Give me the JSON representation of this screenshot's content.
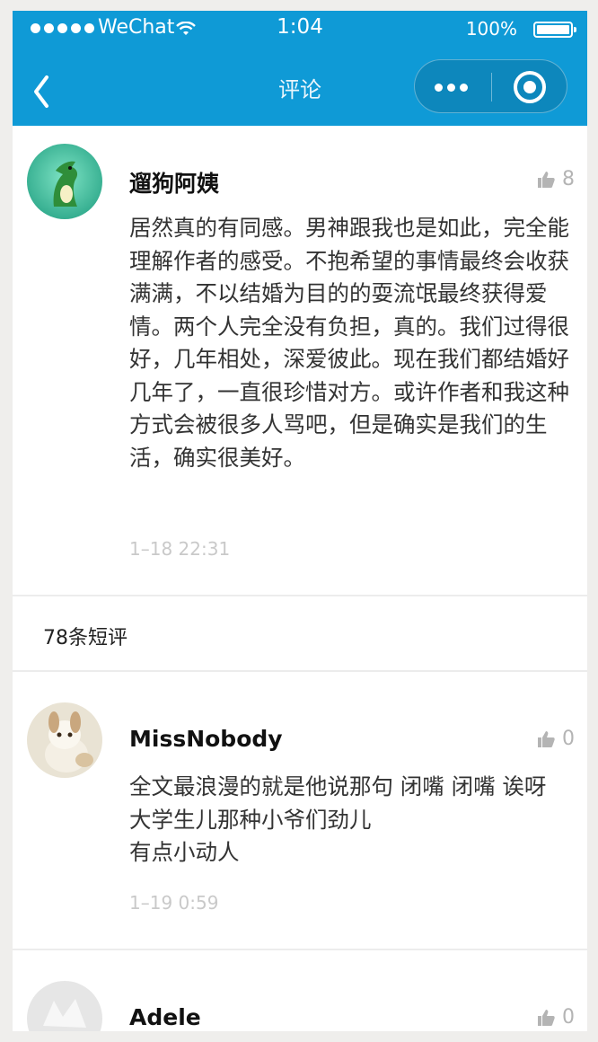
{
  "status_bar": {
    "carrier": "WeChat",
    "time": "1:04",
    "battery": "100%"
  },
  "nav": {
    "title": "评论"
  },
  "colors": {
    "header_bg": "#0f9ad6",
    "text_muted": "#c9c9c9"
  },
  "featured_comment": {
    "author": "遛狗阿姨",
    "likes": "8",
    "text": "居然真的有同感。男神跟我也是如此，完全能理解作者的感受。不抱希望的事情最终会收获满满，不以结婚为目的的耍流氓最终获得爱情。两个人完全没有负担，真的。我们过得很好，几年相处，深爱彼此。现在我们都结婚好几年了，一直很珍惜对方。或许作者和我这种方式会被很多人骂吧，但是确实是我们的生活，确实很美好。",
    "date": "1–18 22:31"
  },
  "short_reviews": {
    "title": "78条短评",
    "items": [
      {
        "author": "MissNobody",
        "likes": "0",
        "text": "全文最浪漫的就是他说那句 闭嘴 闭嘴 诶呀 大学生儿那种小爷们劲儿\n有点小动人",
        "date": "1–19 0:59"
      },
      {
        "author": "Adele",
        "likes": "0"
      }
    ]
  }
}
